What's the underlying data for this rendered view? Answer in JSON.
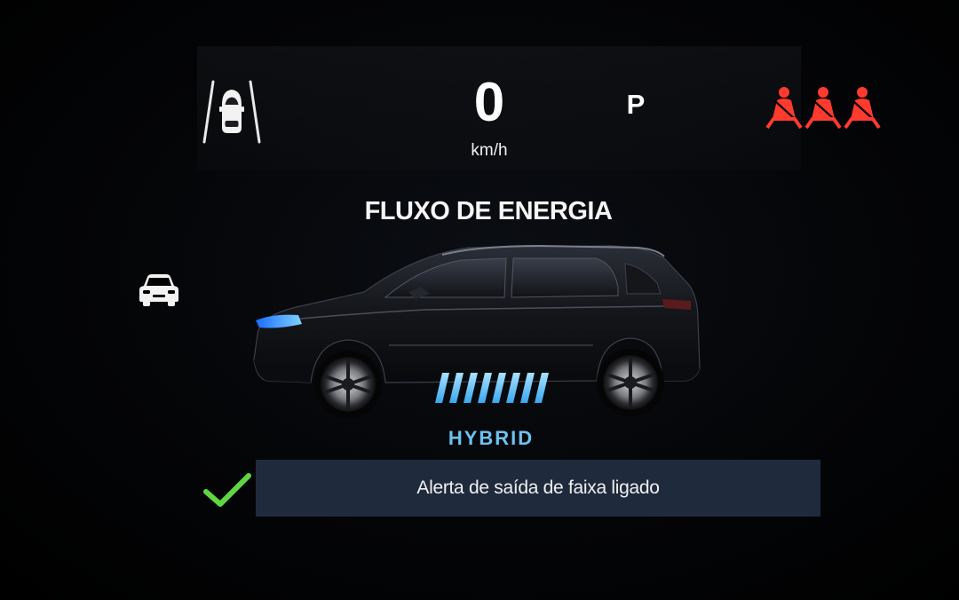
{
  "top": {
    "speed": "0",
    "speed_unit": "km/h",
    "gear": "P",
    "lane_assist_icon": "lane-departure-car-icon",
    "seatbelt_icons": [
      "seatbelt-warning-icon",
      "seatbelt-warning-icon",
      "seatbelt-warning-icon"
    ]
  },
  "energy": {
    "title": "FLUXO DE ENERGIA",
    "mode": "HYBRID",
    "indicator_icon": "energy-flow-stripes-icon",
    "vehicle_icon": "front-car-icon"
  },
  "notification": {
    "text": "Alerta de saída de faixa ligado",
    "icon": "checkmark-icon"
  },
  "colors": {
    "background": "#000000",
    "warning_red": "#ff3a2f",
    "hybrid_blue": "#6cc3f2",
    "check_green": "#5fd640",
    "notice_bar": "#1f2b3d"
  }
}
